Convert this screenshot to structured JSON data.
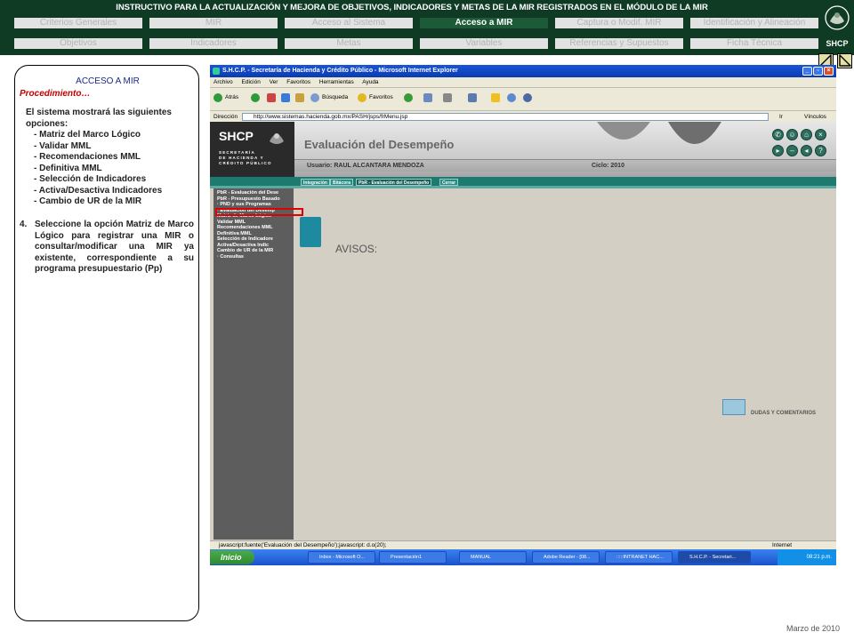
{
  "header": {
    "title": "INSTRUCTIVO PARA  LA ACTUALIZACIÓN Y MEJORA DE OBJETIVOS, INDICADORES Y METAS DE LA MIR REGISTRADOS EN EL MÓDULO DE LA MIR",
    "nav_row1": [
      "Criterios Generales",
      "MIR",
      "Acceso al Sistema",
      "Acceso a MIR",
      "Captura o Modif. MIR",
      "Identificación y Alineación"
    ],
    "nav_row2": [
      "Objetivos",
      "Indicadores",
      "Metas",
      "Variables",
      "Referencias y Supuestos",
      "Ficha Técnica"
    ],
    "active_nav": "Acceso a MIR",
    "logo_label": "SHCP"
  },
  "panel": {
    "title": "ACCESO A MIR",
    "subtitle": "Procedimiento…",
    "intro": "El sistema mostrará las siguientes opciones:",
    "options": [
      "- Matriz del Marco Lógico",
      "- Validar MML",
      "- Recomendaciones MML",
      "- Definitiva MML",
      "- Selección de Indicadores",
      "- Activa/Desactiva Indicadores",
      "- Cambio de UR de la MIR"
    ],
    "step_number": "4.",
    "step_text": "Seleccione la opción Matriz de Marco Lógico para registrar una MIR o consultar/modificar una MIR ya existente, correspondiente a su programa presupuestario (Pp)"
  },
  "footer": {
    "date": "Marzo de 2010"
  },
  "screenshot": {
    "window_title": "S.H.C.P. - Secretaría de Hacienda y Crédito Público - Microsoft Internet Explorer",
    "menu": [
      "Archivo",
      "Edición",
      "Ver",
      "Favoritos",
      "Herramientas",
      "Ayuda"
    ],
    "toolbar": {
      "back": "Atrás",
      "search": "Búsqueda",
      "favorites": "Favoritos"
    },
    "address_label": "Dirección",
    "url": "http://www.sistemas.hacienda.gob.mx/PASH/jsps/frMenu.jsp",
    "go": "Ir",
    "links": "Vínculos",
    "site": {
      "logo": "SHCP",
      "logo_sub": [
        "SECRETARÍA",
        "DE HACIENDA Y",
        "CRÉDITO PÚBLICO"
      ],
      "title": "Evaluación del Desempeño",
      "user": "Usuario: RAUL ALCANTARA MENDOZA",
      "cycle": "Ciclo: 2010",
      "tabs": [
        "Integración",
        "Bitácora",
        "PbR - Evaluación del Desempeño",
        "Cerrar"
      ],
      "left_menu": [
        "PbR - Evaluación del Dese",
        "PbR - Presupuesto Basado",
        "· PND y sus Programas",
        "· Evaluación del Desemp",
        "Matriz de Marco Lógico",
        "Validar MML",
        "Recomendaciones MML",
        "Definitiva MML",
        "Selección de Indicadore",
        "Activa/Desactiva Indic",
        "Cambio de UR de la MIR",
        "· Consultas"
      ],
      "highlighted_item": "Matriz de Marco Lógico",
      "avisos": "AVISOS:",
      "dudas": "DUDAS Y COMENTARIOS"
    },
    "status_text": "javascript:fuente('Evaluación del Desempeño');javascript: d.o(20);",
    "status_zone": "Internet",
    "taskbar": {
      "start": "Inicio",
      "tasks": [
        "Inbox - Microsoft O...",
        "Presentación1",
        "MANUAL",
        "Adobe Reader - [08...",
        ":::::INTRANET HAC...",
        "S.H.C.P. - Secretari..."
      ],
      "clock": "08:21 p.m."
    }
  }
}
